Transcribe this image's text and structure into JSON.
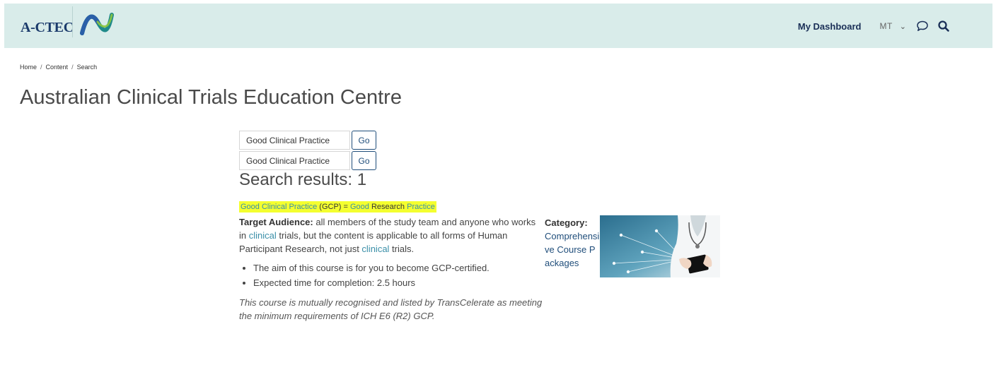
{
  "header": {
    "brand": "A-CTEC",
    "dashboard_label": "My Dashboard",
    "user_initials": "MT",
    "chevron": "⌄",
    "icons": [
      "chat-bubble-icon",
      "search-icon"
    ]
  },
  "breadcrumb": {
    "items": [
      "Home",
      "Content",
      "Search"
    ],
    "separator": "/"
  },
  "page_title": "Australian Clinical Trials Education Centre",
  "search_forms": [
    {
      "value": "Good Clinical Practice",
      "button": "Go"
    },
    {
      "value": "Good Clinical Practice",
      "button": "Go"
    }
  ],
  "results_heading": "Search results: 1",
  "result": {
    "title_parts": [
      "Good Clinical Practice",
      " (GCP) = ",
      "Good",
      " Research ",
      "Practice"
    ],
    "target_audience_label": "Target Audience:",
    "target_audience_text": [
      " all members of the study team and anyone who works in ",
      "clinical",
      " trials, but the content is applicable to all forms of Human Participant Research, not just ",
      "clinical",
      " trials."
    ],
    "bullets": [
      "The aim of this course  is for you to become GCP-certified.",
      "Expected time for completion: 2.5 hours"
    ],
    "note": "This course is mutually recognised and listed by TransCelerate as meeting the minimum requirements of ICH E6 (R2) GCP.",
    "category_label": "Category:",
    "category_value": "Comprehensive Course Packages"
  },
  "colors": {
    "header_bg": "#d9ecea",
    "brand_navy": "#1a3a6b",
    "highlight": "#f4ff2f",
    "keyword": "#3a8fa8",
    "link_navy": "#1f4d7a"
  }
}
